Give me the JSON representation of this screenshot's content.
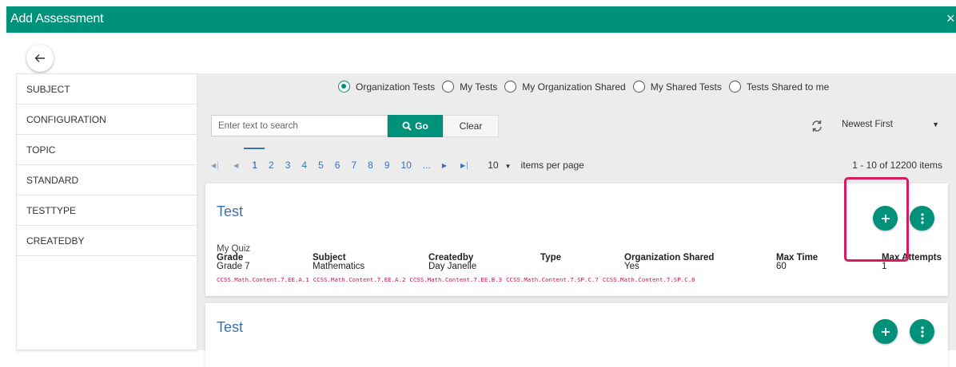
{
  "window": {
    "title": "Add Assessment",
    "close": "×",
    "accent": "#00917a"
  },
  "sidebar": {
    "items": [
      {
        "label": "SUBJECT"
      },
      {
        "label": "CONFIGURATION"
      },
      {
        "label": "TOPIC"
      },
      {
        "label": "STANDARD"
      },
      {
        "label": "TESTTYPE"
      },
      {
        "label": "CREATEDBY"
      }
    ]
  },
  "filters": {
    "selected": "Organization Tests",
    "options": [
      {
        "label": "Organization Tests"
      },
      {
        "label": "My Tests"
      },
      {
        "label": "My Organization Shared"
      },
      {
        "label": "My Shared Tests"
      },
      {
        "label": "Tests Shared to me"
      }
    ]
  },
  "search": {
    "placeholder": "Enter text to search",
    "go_label": "Go",
    "clear_label": "Clear"
  },
  "sort": {
    "selected": "Newest First"
  },
  "pagination": {
    "pages": [
      "1",
      "2",
      "3",
      "4",
      "5",
      "6",
      "7",
      "8",
      "9",
      "10",
      "..."
    ],
    "current": "1",
    "page_size": "10",
    "items_per_page_label": "items per page",
    "range": "1 - 10 of 12200 items"
  },
  "tests": [
    {
      "title": "Test",
      "quiz_name": "My Quiz",
      "fields": [
        {
          "label": "Grade",
          "value": "Grade 7"
        },
        {
          "label": "Subject",
          "value": "Mathematics"
        },
        {
          "label": "Createdby",
          "value": "Day Janelle"
        },
        {
          "label": "Type",
          "value": ""
        },
        {
          "label": "Organization Shared",
          "value": "Yes"
        },
        {
          "label": "Max Time",
          "value": "60"
        },
        {
          "label": "Max Attempts",
          "value": "1"
        }
      ],
      "standards": [
        "CCSS.Math.Content.7.EE.A.1",
        "CCSS.Math.Content.7.EE.A.2",
        "CCSS.Math.Content.7.EE.B.3",
        "CCSS.Math.Content.7.SP.C.7",
        "CCSS.Math.Content.7.SP.C.8"
      ]
    },
    {
      "title": "Test"
    }
  ]
}
